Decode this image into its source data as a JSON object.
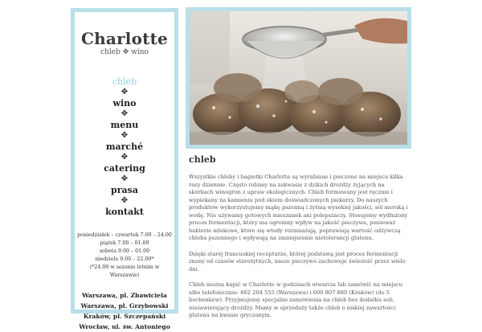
{
  "brand": {
    "name": "Charlotte",
    "tagline": "chleb ✥ wino"
  },
  "nav": {
    "separator": "✥",
    "items": [
      {
        "label": "chleb",
        "active": true
      },
      {
        "label": "wino",
        "active": false
      },
      {
        "label": "menu",
        "active": false
      },
      {
        "label": "marché",
        "active": false
      },
      {
        "label": "catering",
        "active": false
      },
      {
        "label": "prasa",
        "active": false
      },
      {
        "label": "kontakt",
        "active": false
      }
    ]
  },
  "hours": [
    "poniedziałek – czwartek 7.00 – 24.00",
    "piątek 7.00 – 01.00",
    "sobota 9.00 – 01.00",
    "niedziela 9.00 – 22.00*",
    "(*24.00 w sezonie letnim w Warszawie)"
  ],
  "locations": [
    "Warszawa, pl. Zbawiciela",
    "Warszawa, pl. Grzybowski",
    "Kraków, pl. Szczepański",
    "Wrocław, ul. św. Antoniego"
  ],
  "hero": {
    "alt_icon": "bread-flour-sieve-photo"
  },
  "main": {
    "heading": "chleb",
    "paragraphs": [
      "Wszystkie chleby i bagietki Charlotte są wyrabiane i pieczone na miejscu kilka razy dziennie. Często robimy na zakwasie z dzikich drożdży żyjących na skórkach winogron z upraw ekologicznych. Chleb formowany jest ręcznie i wypiekany na kamieniu pod okiem doświadczonych piekarzy. Do naszych produktów wykorzystujemy mąkę pszenną i żytnią wysokiej jakości, sól morską i wodę. Nie używamy gotowych mieszanek ani polepszaczy. Stosujemy wydłużony proces fermentacji, który ma ogromny wpływ na jakość pieczywa, ponieważ bakterie mlekowe, które się wtedy rozmnażają, poprawiają wartość odżywczą chleba pszennego i wpływają na zmniejszenie nietolerancji glutenu.",
      "Dzięki starej francuskiej recepturze, której podstawą jest proces fermentacji znany od czasów starożytnych, nasze pieczywo zachowuje świeżość przez wiele dni.",
      "Chleb można kupić w Charlotte w godzinach otwarcia lub zamówić na miejscu albo telefonicznie: 662 204 555 (Warszawa) i 600 807 880 (Kraków) (do 5 bochenków). Przyjmujemy specjalne zamówienia na chleb bez dodatku soli, niezawierający drożdży. Mamy w sprzedaży także chleb o niskiej zawartości glutenu na kwasie gryczanym."
    ]
  },
  "colors": {
    "accent_border": "#b9dfe9",
    "active_nav": "#8ccfe0"
  }
}
